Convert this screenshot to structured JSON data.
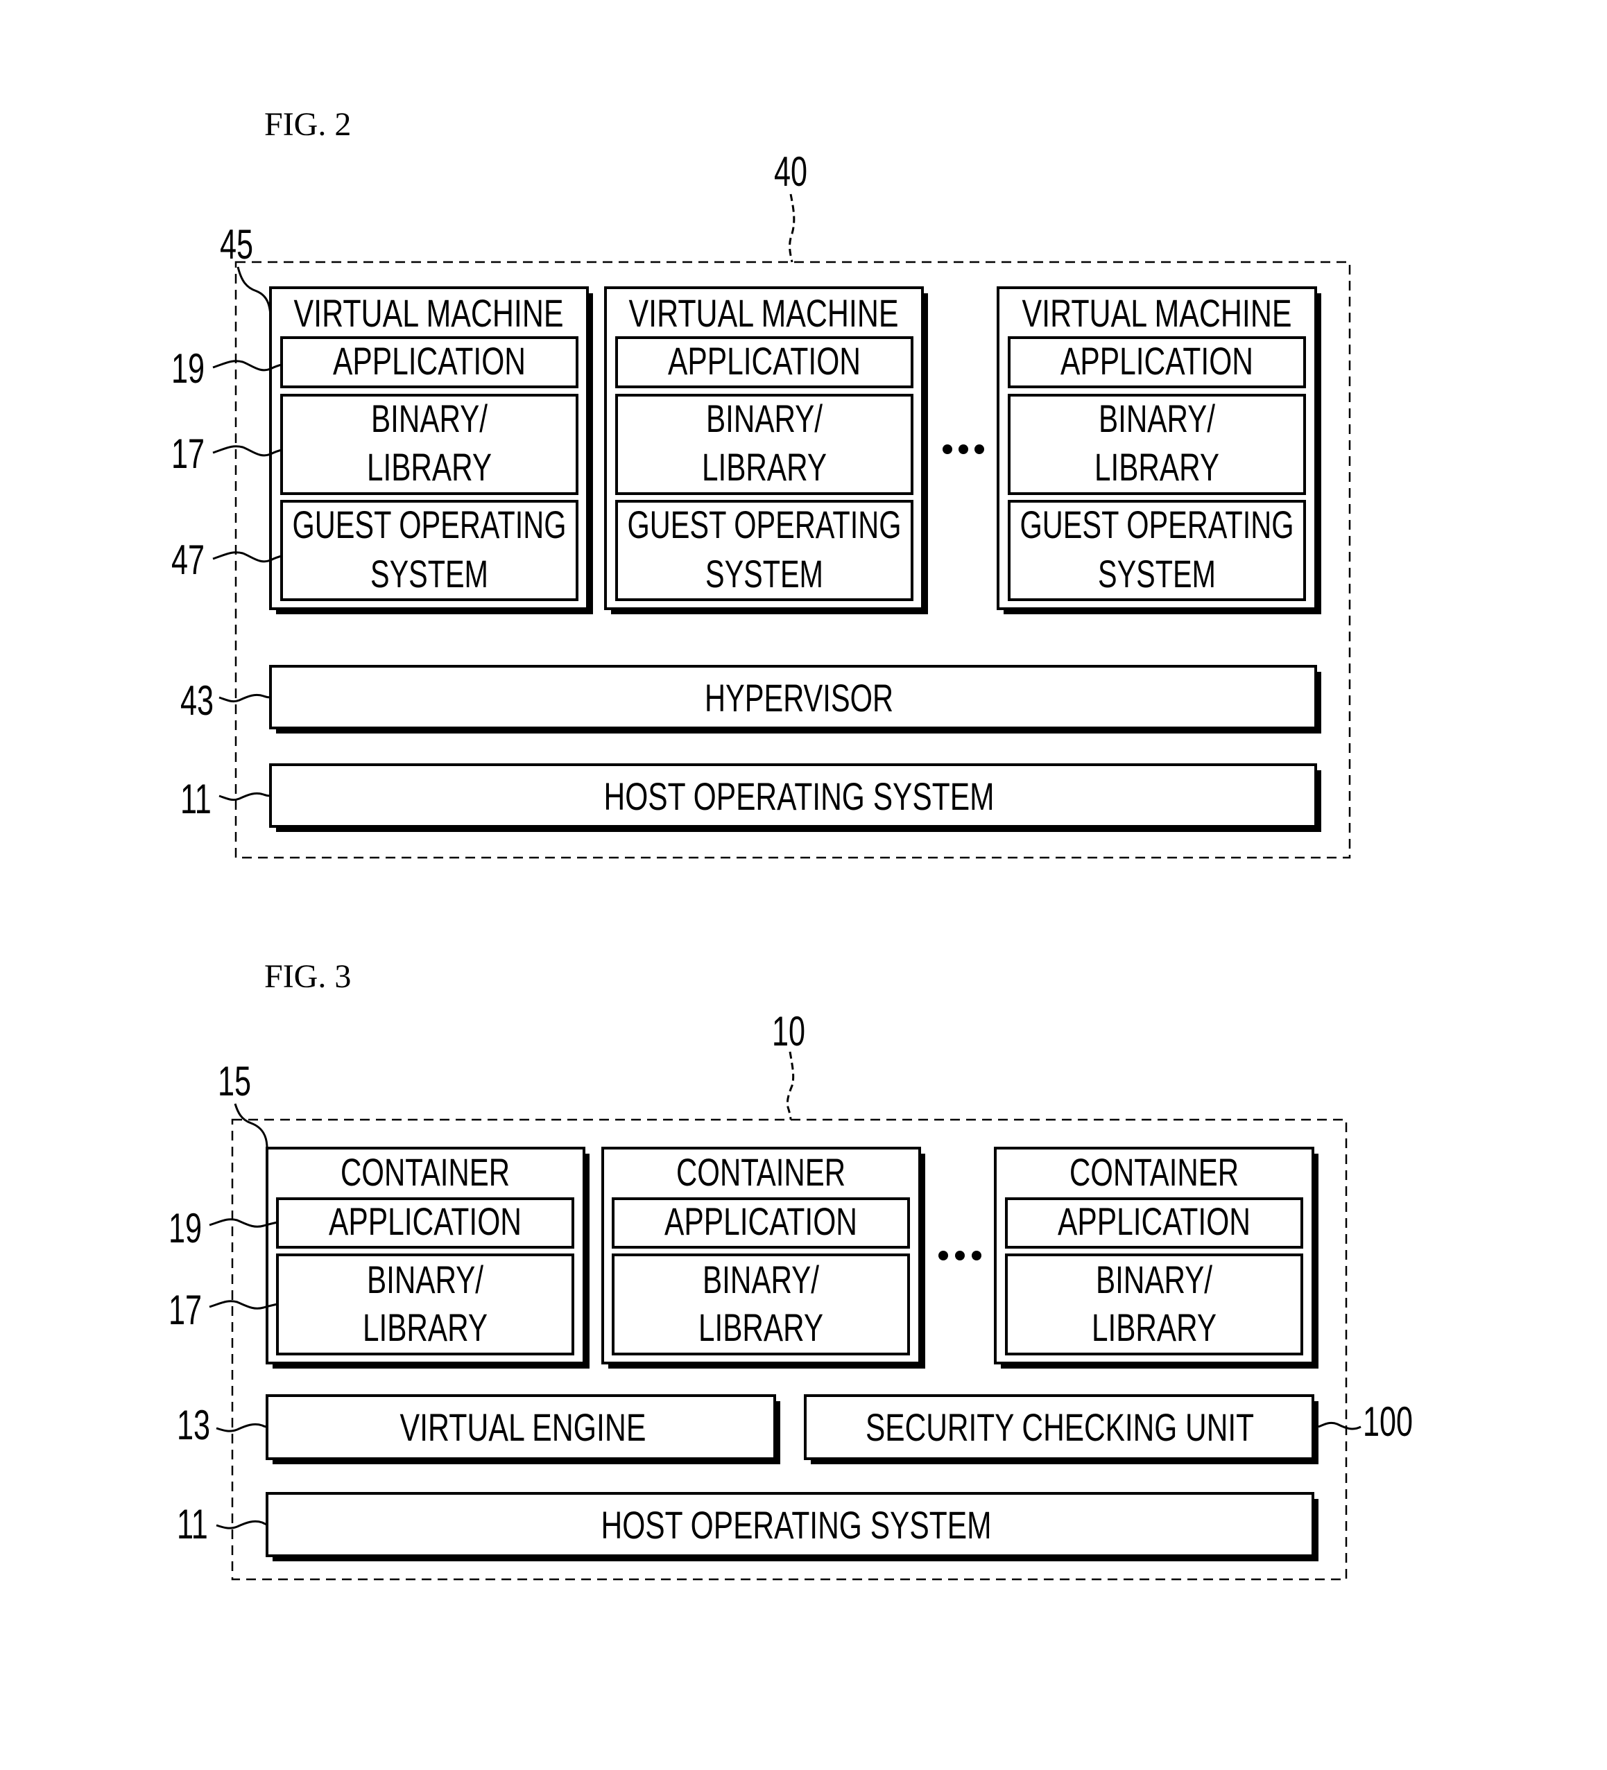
{
  "fig2": {
    "title": "FIG. 2",
    "ref_outer": "40",
    "ref_vm": "45",
    "ref_app": "19",
    "ref_bin": "17",
    "ref_guest": "47",
    "ref_hyper": "43",
    "ref_host": "11",
    "vm_label": "VIRTUAL MACHINE",
    "app_label": "APPLICATION",
    "bin_line1": "BINARY/",
    "bin_line2": "LIBRARY",
    "guest_line1": "GUEST OPERATING",
    "guest_line2": "SYSTEM",
    "hypervisor": "HYPERVISOR",
    "host_os": "HOST OPERATING SYSTEM"
  },
  "fig3": {
    "title": "FIG. 3",
    "ref_outer": "10",
    "ref_container": "15",
    "ref_app": "19",
    "ref_bin": "17",
    "ref_engine": "13",
    "ref_host": "11",
    "ref_security": "100",
    "container_label": "CONTAINER",
    "app_label": "APPLICATION",
    "bin_line1": "BINARY/",
    "bin_line2": "LIBRARY",
    "virtual_engine": "VIRTUAL ENGINE",
    "security_unit": "SECURITY CHECKING UNIT",
    "host_os": "HOST OPERATING SYSTEM"
  }
}
